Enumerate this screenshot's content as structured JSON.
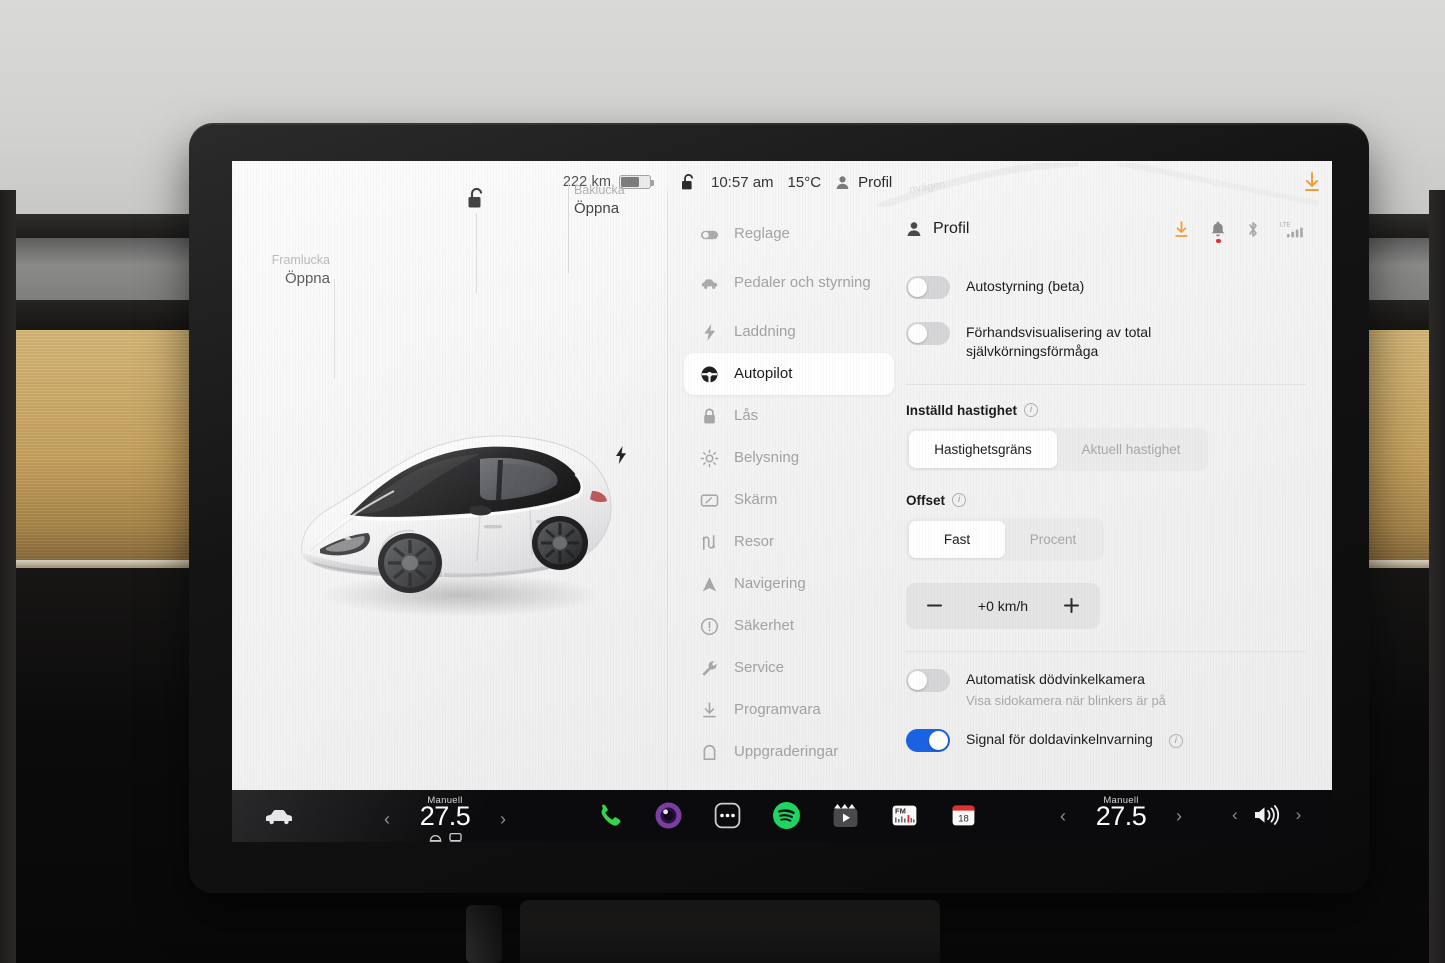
{
  "topbar": {
    "range": "222 km",
    "battery_pct": 58,
    "lock_icon": "unlock-icon",
    "time": "10:57 am",
    "temperature": "15°C",
    "profile": "Profil",
    "download_icon": "download-icon",
    "map_street_ghost": "nvägen"
  },
  "car_panel": {
    "front_trunk": {
      "caption": "Framlucka",
      "action": "Öppna"
    },
    "rear_trunk": {
      "caption": "Baklucka",
      "action": "Öppna"
    },
    "roof_icon": "unlock-icon",
    "charge_icon": "charge-bolt-icon",
    "vehicle": "tesla-model-3-white"
  },
  "sidebar": {
    "items": [
      {
        "label": "Reglage",
        "icon": "toggle-icon",
        "active": false
      },
      {
        "label": "Pedaler och styrning",
        "icon": "car-side-icon",
        "active": false,
        "two_line": true
      },
      {
        "label": "Laddning",
        "icon": "bolt-icon",
        "active": false
      },
      {
        "label": "Autopilot",
        "icon": "steering-wheel-icon",
        "active": true
      },
      {
        "label": "Lås",
        "icon": "lock-icon",
        "active": false
      },
      {
        "label": "Belysning",
        "icon": "sun-icon",
        "active": false
      },
      {
        "label": "Skärm",
        "icon": "display-icon",
        "active": false
      },
      {
        "label": "Resor",
        "icon": "trips-icon",
        "active": false
      },
      {
        "label": "Navigering",
        "icon": "navigation-arrow-icon",
        "active": false
      },
      {
        "label": "Säkerhet",
        "icon": "alert-circle-icon",
        "active": false
      },
      {
        "label": "Service",
        "icon": "wrench-icon",
        "active": false
      },
      {
        "label": "Programvara",
        "icon": "download-icon",
        "active": false
      },
      {
        "label": "Uppgraderingar",
        "icon": "upgrade-icon",
        "active": false
      }
    ]
  },
  "panel": {
    "title": "Profil",
    "title_icon": "person-icon",
    "status_icons": [
      {
        "name": "download-icon",
        "color": "#f0a03c",
        "badge": false
      },
      {
        "name": "bell-icon",
        "color": "#8a8a8c",
        "badge": true,
        "badge_color": "#e03030"
      },
      {
        "name": "bluetooth-icon",
        "color": "#a8a8aa",
        "badge": false
      },
      {
        "name": "lte-signal-icon",
        "color": "#a8a8aa",
        "badge": false,
        "label": "LTE"
      }
    ],
    "toggles_top": [
      {
        "label": "Autostyrning (beta)",
        "on": false
      },
      {
        "label": "Förhandsvisualisering av total självkörningsförmåga",
        "on": false
      }
    ],
    "set_speed": {
      "label": "Inställd hastighet",
      "info_icon": "info-icon",
      "options": [
        "Hastighetsgräns",
        "Aktuell hastighet"
      ],
      "selected": "Hastighetsgräns"
    },
    "offset": {
      "label": "Offset",
      "info_icon": "info-icon",
      "options": [
        "Fast",
        "Procent"
      ],
      "selected": "Fast",
      "value": "+0 km/h",
      "minus_icon": "minus-icon",
      "plus_icon": "plus-icon"
    },
    "toggles_bottom": [
      {
        "label": "Automatisk dödvinkelkamera",
        "sublabel": "Visa sidokamera när blinkers är på",
        "on": false,
        "info_icon": null
      },
      {
        "label": "Signal för doldavinkelnvarning",
        "sublabel": null,
        "on": true,
        "info_icon": "info-icon"
      }
    ]
  },
  "taskbar": {
    "car_icon": "car-icon",
    "climate_left": {
      "mode": "Manuell",
      "temperature": "27.5",
      "prev_icon": "chevron-left-icon",
      "next_icon": "chevron-right-icon",
      "seat_icons": [
        "seat-heater-icon",
        "defrost-icon"
      ]
    },
    "climate_right": {
      "mode": "Manuell",
      "temperature": "27.5",
      "prev_icon": "chevron-left-icon",
      "next_icon": "chevron-right-icon"
    },
    "apps": [
      {
        "name": "phone-app",
        "icon": "phone-icon",
        "color": "#32d74b"
      },
      {
        "name": "camera-app",
        "icon": "camera-lens-icon",
        "color": "#7b3fa0"
      },
      {
        "name": "more-apps",
        "icon": "ellipsis-icon",
        "color": "#ffffff"
      },
      {
        "name": "spotify-app",
        "icon": "spotify-icon",
        "color": "#1ed760"
      },
      {
        "name": "theater-app",
        "icon": "clapperboard-icon",
        "color": "#4a4a4c"
      },
      {
        "name": "radio-app",
        "icon": "fm-radio-icon",
        "color": "#ffffff",
        "label": "FM"
      },
      {
        "name": "calendar-app",
        "icon": "calendar-icon",
        "color": "#ffffff",
        "label": "18"
      }
    ],
    "volume": {
      "icon": "volume-icon",
      "prev_icon": "chevron-left-icon",
      "next_icon": "chevron-right-icon"
    }
  },
  "colors": {
    "accent_blue": "#1b63e5",
    "accent_orange": "#f0a03c",
    "badge_red": "#e03030",
    "screen_bg": "#f4f4f4",
    "taskbar_bg": "#0b0b0d"
  }
}
